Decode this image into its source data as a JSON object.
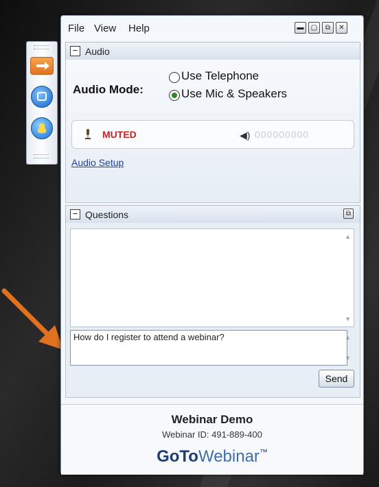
{
  "menubar": {
    "file": "File",
    "view": "View",
    "help": "Help"
  },
  "audio": {
    "title": "Audio",
    "mode_label": "Audio Mode:",
    "options": [
      "Use Telephone",
      "Use Mic & Speakers"
    ],
    "selected": "Use Mic & Speakers",
    "mute_status": "MUTED",
    "level_display": "000000000",
    "setup_link": "Audio Setup"
  },
  "questions": {
    "title": "Questions",
    "input_value": "How do I register to attend a webinar?",
    "send_label": "Send"
  },
  "footer": {
    "webinar_title": "Webinar Demo",
    "webinar_id": "Webinar ID: 491-889-400",
    "logo_goto": "GoTo",
    "logo_webinar": "Webinar",
    "logo_tm": "™"
  },
  "colors": {
    "muted": "#cc2222",
    "link": "#1a3fb0",
    "arrow": "#e0711e"
  }
}
